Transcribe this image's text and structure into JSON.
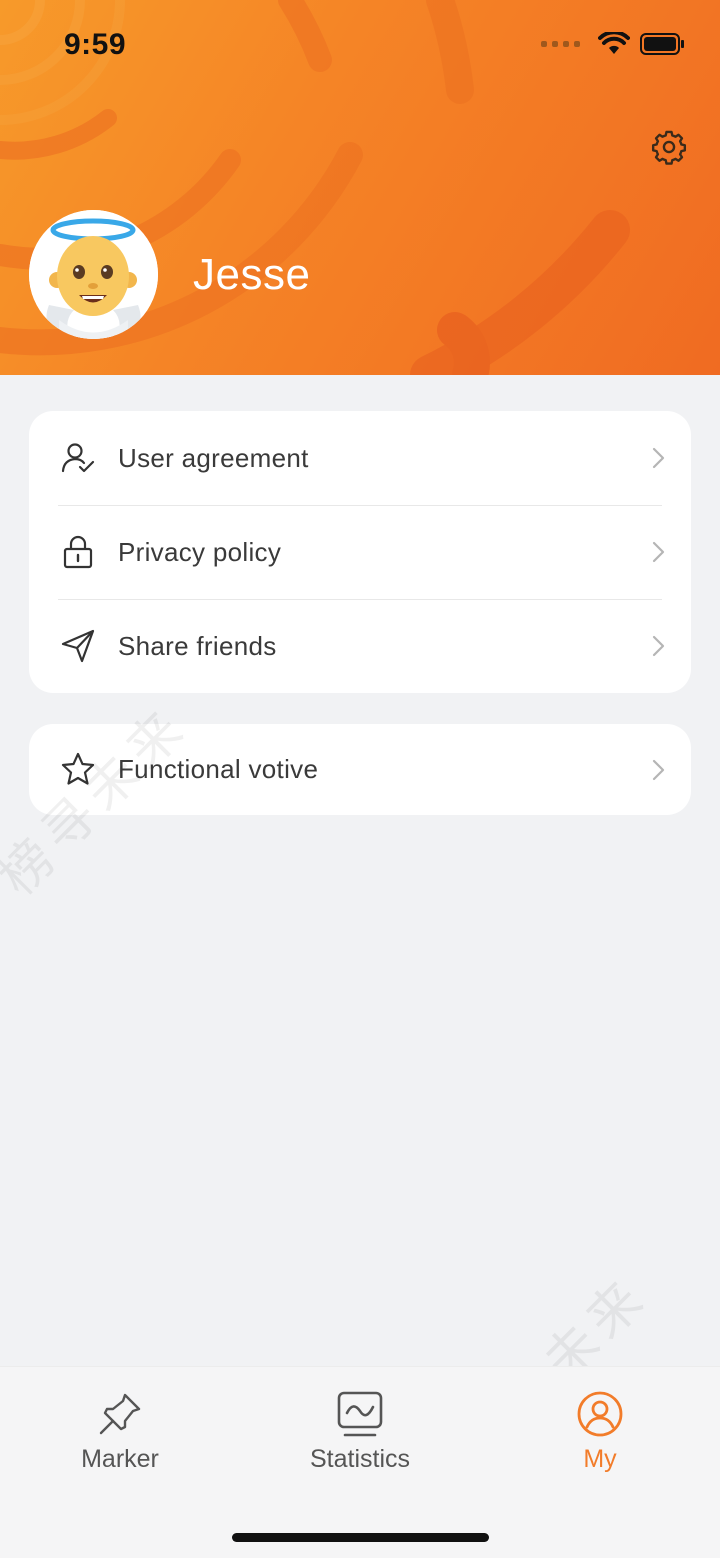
{
  "status_bar": {
    "time": "9:59",
    "icons": [
      "signal-icon",
      "wifi-icon",
      "battery-icon"
    ]
  },
  "header": {
    "username": "Jesse",
    "avatar_icon": "angel-emoji-avatar",
    "settings_icon": "gear-icon",
    "colors": {
      "gradient_start": "#f79a2a",
      "gradient_end": "#f06b22"
    }
  },
  "menu": {
    "group1": [
      {
        "label": "User agreement",
        "icon": "user-check-icon"
      },
      {
        "label": "Privacy policy",
        "icon": "lock-icon"
      },
      {
        "label": "Share friends",
        "icon": "send-icon"
      }
    ],
    "group2": [
      {
        "label": "Functional votive",
        "icon": "star-icon"
      }
    ]
  },
  "watermark": "榜寻未来",
  "tabbar": {
    "tabs": [
      {
        "label": "Marker",
        "icon": "pin-icon",
        "active": false
      },
      {
        "label": "Statistics",
        "icon": "monitor-chart-icon",
        "active": false
      },
      {
        "label": "My",
        "icon": "profile-icon",
        "active": true
      }
    ],
    "accent_color": "#f27c2a"
  }
}
